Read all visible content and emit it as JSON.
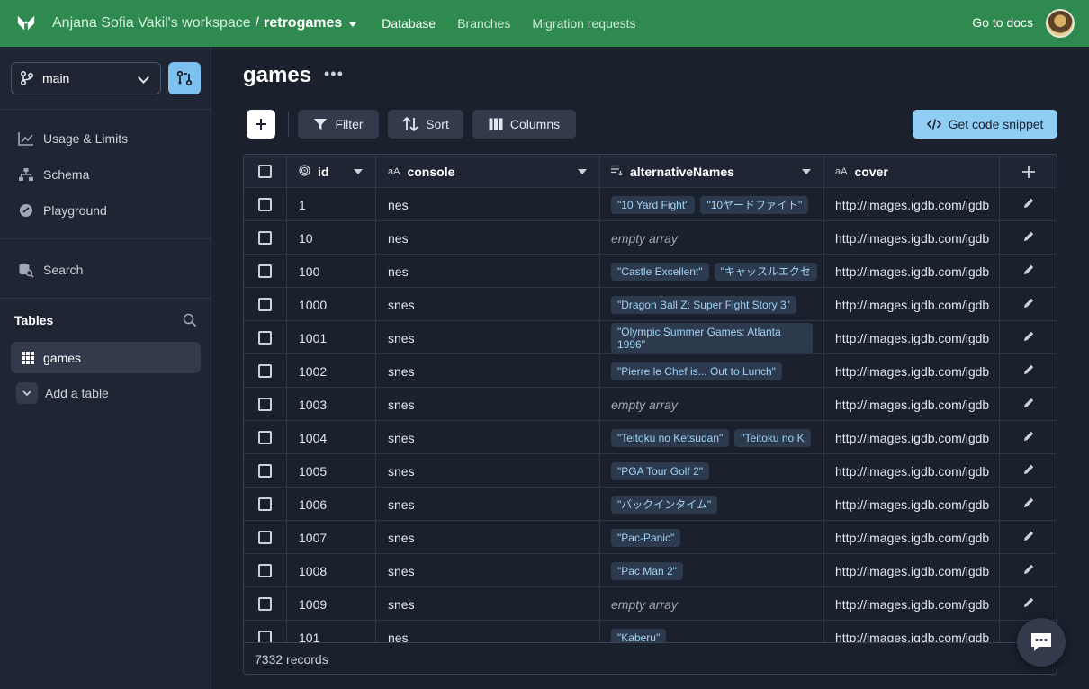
{
  "topbar": {
    "workspace": "Anjana Sofia Vakil's workspace",
    "separator": "/",
    "database": "retrogames",
    "nav": [
      "Database",
      "Branches",
      "Migration requests"
    ],
    "docs": "Go to docs"
  },
  "sidebar": {
    "branch": "main",
    "items": [
      "Usage & Limits",
      "Schema",
      "Playground"
    ],
    "search": "Search",
    "tables_header": "Tables",
    "table": "games",
    "add_table": "Add a table"
  },
  "main": {
    "title": "games",
    "dots": "•••",
    "filter": "Filter",
    "sort": "Sort",
    "columns": "Columns",
    "snippet": "Get code snippet",
    "footer": "7332 records"
  },
  "table": {
    "headers": [
      "id",
      "console",
      "alternativeNames",
      "cover"
    ],
    "rows": [
      {
        "id": "1",
        "console": "nes",
        "names": [
          "\"10 Yard Fight\"",
          "\"10ヤードファイト\""
        ],
        "cover": "http://images.igdb.com/igdb"
      },
      {
        "id": "10",
        "console": "nes",
        "names": [],
        "cover": "http://images.igdb.com/igdb"
      },
      {
        "id": "100",
        "console": "nes",
        "names": [
          "\"Castle Excellent\"",
          "\"キャッスルエクセ"
        ],
        "cover": "http://images.igdb.com/igdb"
      },
      {
        "id": "1000",
        "console": "snes",
        "names": [
          "\"Dragon Ball Z: Super Fight Story 3\""
        ],
        "cover": "http://images.igdb.com/igdb"
      },
      {
        "id": "1001",
        "console": "snes",
        "names": [
          "\"Olympic Summer Games: Atlanta 1996\""
        ],
        "cover": "http://images.igdb.com/igdb"
      },
      {
        "id": "1002",
        "console": "snes",
        "names": [
          "\"Pierre le Chef is... Out to Lunch\""
        ],
        "cover": "http://images.igdb.com/igdb"
      },
      {
        "id": "1003",
        "console": "snes",
        "names": [],
        "cover": "http://images.igdb.com/igdb"
      },
      {
        "id": "1004",
        "console": "snes",
        "names": [
          "\"Teitoku no Ketsudan\"",
          "\"Teitoku no K"
        ],
        "cover": "http://images.igdb.com/igdb"
      },
      {
        "id": "1005",
        "console": "snes",
        "names": [
          "\"PGA Tour Golf 2\""
        ],
        "cover": "http://images.igdb.com/igdb"
      },
      {
        "id": "1006",
        "console": "snes",
        "names": [
          "\"バックインタイム\""
        ],
        "cover": "http://images.igdb.com/igdb"
      },
      {
        "id": "1007",
        "console": "snes",
        "names": [
          "\"Pac-Panic\""
        ],
        "cover": "http://images.igdb.com/igdb"
      },
      {
        "id": "1008",
        "console": "snes",
        "names": [
          "\"Pac Man 2\""
        ],
        "cover": "http://images.igdb.com/igdb"
      },
      {
        "id": "1009",
        "console": "snes",
        "names": [],
        "cover": "http://images.igdb.com/igdb"
      },
      {
        "id": "101",
        "console": "nes",
        "names": [
          "\"Kaberu\""
        ],
        "cover": "http://images.igdb.com/igdb"
      }
    ],
    "empty_label": "empty array"
  }
}
